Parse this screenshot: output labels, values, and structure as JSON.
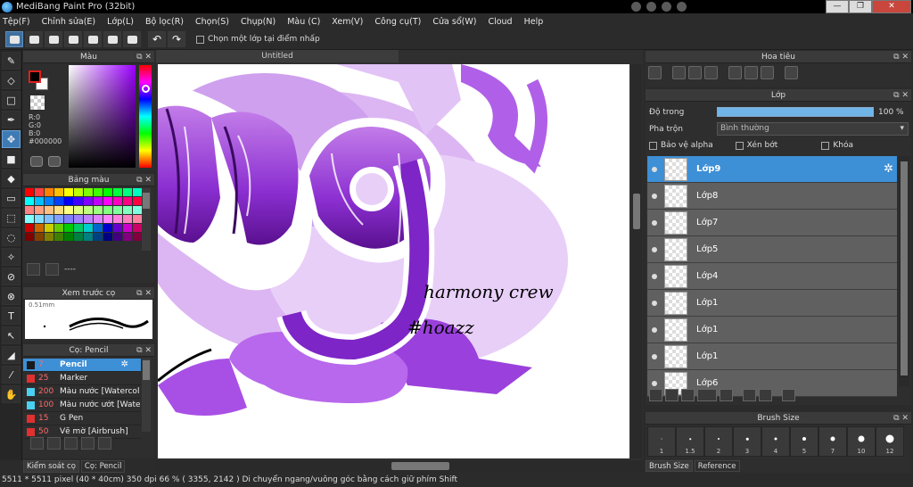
{
  "window": {
    "title": "MediBang Paint Pro (32bit)",
    "btn_min": "—",
    "btn_max": "❐",
    "btn_close": "✕"
  },
  "menu": [
    "Tệp(F)",
    "Chỉnh sửa(E)",
    "Lớp(L)",
    "Bộ lọc(R)",
    "Chọn(S)",
    "Chụp(N)",
    "Màu (C)",
    "Xem(V)",
    "Công cụ(T)",
    "Cửa sổ(W)",
    "Cloud",
    "Help"
  ],
  "toolbar": {
    "snap_label": "Chọn một lớp tại điểm nhấp"
  },
  "panels": {
    "color": "Màu",
    "palette": "Bảng màu",
    "preview": "Xem trước cọ",
    "brush": "Cọ: Pencil",
    "navigator": "Hoa tiêu",
    "layer": "Lớp",
    "brush_size": "Brush Size"
  },
  "color": {
    "r": "R:0",
    "g": "G:0",
    "b": "B:0",
    "hex": "#000000",
    "fg": "#000000",
    "bg": "#ffffff"
  },
  "palette": {
    "colors": [
      "#ff0000",
      "#ff4040",
      "#ff8000",
      "#ffbf00",
      "#ffff00",
      "#bfff00",
      "#80ff00",
      "#40ff00",
      "#00ff00",
      "#00ff40",
      "#00ff80",
      "#00ffbf",
      "#00ffff",
      "#00bfff",
      "#0080ff",
      "#0040ff",
      "#0000ff",
      "#4000ff",
      "#8000ff",
      "#bf00ff",
      "#ff00ff",
      "#ff00bf",
      "#ff0080",
      "#ff0040",
      "#ff8080",
      "#ff9f80",
      "#ffbf80",
      "#ffdf80",
      "#ffff80",
      "#dfff80",
      "#bfff80",
      "#9fff80",
      "#80ff80",
      "#80ff9f",
      "#80ffbf",
      "#80ffdf",
      "#80ffff",
      "#80dfff",
      "#80bfff",
      "#809fff",
      "#8080ff",
      "#9f80ff",
      "#bf80ff",
      "#df80ff",
      "#ff80ff",
      "#ff80df",
      "#ff80bf",
      "#ff809f",
      "#cc0000",
      "#cc6600",
      "#cccc00",
      "#66cc00",
      "#00cc00",
      "#00cc66",
      "#00cccc",
      "#0066cc",
      "#0000cc",
      "#6600cc",
      "#cc00cc",
      "#cc0066",
      "#800000",
      "#804000",
      "#808000",
      "#408000",
      "#008000",
      "#008040",
      "#008080",
      "#004080",
      "#000080",
      "#400080",
      "#800080",
      "#800040"
    ],
    "foot_text": "----"
  },
  "preview": {
    "size": "0.51mm"
  },
  "brushes": [
    {
      "size": "7",
      "name": "Pencil",
      "color": "#1a1a1a",
      "selected": true
    },
    {
      "size": "25",
      "name": "Marker",
      "color": "#e03030"
    },
    {
      "size": "200",
      "name": "Màu nước [Watercolor]",
      "color": "#4ad0f0"
    },
    {
      "size": "100",
      "name": "Màu nước ướt [Watercolor Wet]",
      "color": "#4ad0f0"
    },
    {
      "size": "15",
      "name": "G Pen",
      "color": "#e03030"
    },
    {
      "size": "50",
      "name": "Vẽ mờ [Airbrush]",
      "color": "#e03030"
    }
  ],
  "left_tabs": [
    "Kiểm soát cọ",
    "Cọ: Pencil"
  ],
  "canvas": {
    "tab": "Untitled",
    "text1": "harmony crew",
    "text2": "#hoazz"
  },
  "layer": {
    "opacity_label": "Độ trong",
    "opacity_value": "100 %",
    "opacity": 1.0,
    "blend_label": "Pha trộn",
    "blend_value": "Bình thường",
    "chk_alpha": "Bảo vệ alpha",
    "chk_clip": "Xén bớt",
    "chk_lock": "Khóa",
    "items": [
      "Lớp9",
      "Lớp8",
      "Lớp7",
      "Lớp5",
      "Lớp4",
      "Lớp1",
      "Lớp1",
      "Lớp1",
      "Lớp6"
    ]
  },
  "brush_sizes": [
    {
      "label": "1",
      "d": 1
    },
    {
      "label": "1.5",
      "d": 1.5
    },
    {
      "label": "2",
      "d": 2
    },
    {
      "label": "3",
      "d": 2.5
    },
    {
      "label": "4",
      "d": 3
    },
    {
      "label": "5",
      "d": 4
    },
    {
      "label": "7",
      "d": 5
    },
    {
      "label": "10",
      "d": 7
    },
    {
      "label": "12",
      "d": 9
    }
  ],
  "right_tabs": [
    "Brush Size",
    "Reference"
  ],
  "status": "5511 * 5511 pixel   (40 * 40cm)   350 dpi   66 %   ( 3355, 2142 )   Di chuyển ngang/vuông góc bằng cách giữ phím Shift"
}
